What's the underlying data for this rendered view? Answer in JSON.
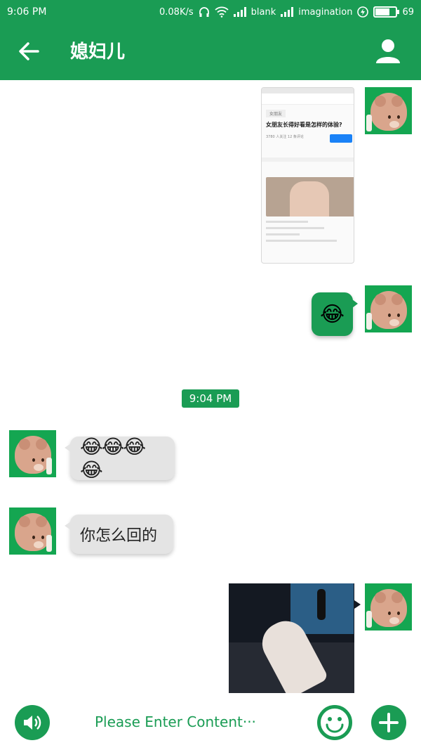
{
  "status_bar": {
    "time": "9:06 PM",
    "net_speed": "0.08K/s",
    "carrier1": "blank",
    "carrier2": "imagination",
    "battery": "69",
    "battery_level_percent": 69
  },
  "app_bar": {
    "title": "媳妇儿",
    "icons": [
      "back-arrow-icon",
      "person-icon"
    ]
  },
  "messages": [
    {
      "side": "right",
      "type": "image",
      "content": "screenshot",
      "screenshot": {
        "tag": "女朋友",
        "question": "女朋友长得好看是怎样的体验?",
        "meta": "3780 人关注  12 条评论"
      }
    },
    {
      "side": "right",
      "type": "emoji",
      "text": "😂"
    },
    {
      "side": "center",
      "type": "time",
      "text": "9:04 PM"
    },
    {
      "side": "left",
      "type": "emoji",
      "text": "😂😂😂😂"
    },
    {
      "side": "left",
      "type": "text",
      "text": "你怎么回的"
    },
    {
      "side": "right",
      "type": "image",
      "content": "photo"
    }
  ],
  "input_bar": {
    "placeholder": "Please Enter Content···",
    "icons": [
      "speaker-icon",
      "smiley-icon",
      "plus-icon"
    ]
  },
  "colors": {
    "accent": "#1a9c54",
    "bubble_left": "#e4e4e4",
    "background": "#ffffff"
  }
}
